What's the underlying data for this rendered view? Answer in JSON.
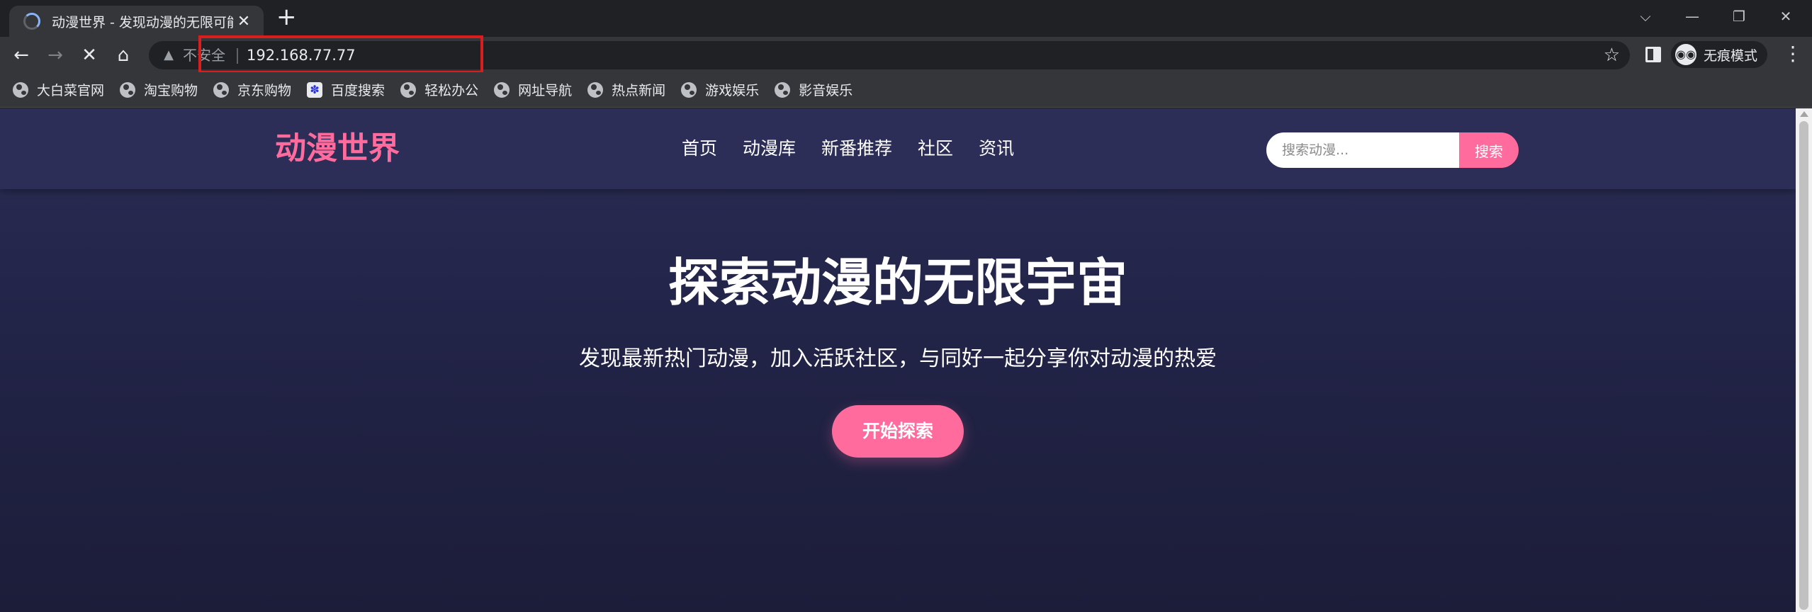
{
  "browser": {
    "tab": {
      "title": "动漫世界 - 发现动漫的无限可能",
      "close_glyph": "✕"
    },
    "new_tab_glyph": "+",
    "window_controls": {
      "tab_search": "⌵",
      "minimize": "—",
      "restore": "❐",
      "close": "✕"
    },
    "toolbar": {
      "back_glyph": "←",
      "forward_glyph": "→",
      "stop_glyph": "✕",
      "home_glyph": "⌂",
      "security_label": "不安全",
      "url": "192.168.77.77",
      "star_glyph": "☆",
      "profile_label": "无痕模式",
      "menu_glyph": "⋮"
    },
    "bookmarks": [
      {
        "label": "大白菜官网",
        "icon": "globe-icon"
      },
      {
        "label": "淘宝购物",
        "icon": "globe-icon"
      },
      {
        "label": "京东购物",
        "icon": "globe-icon"
      },
      {
        "label": "百度搜索",
        "icon": "baidu-paw-icon"
      },
      {
        "label": "轻松办公",
        "icon": "globe-icon"
      },
      {
        "label": "网址导航",
        "icon": "globe-icon"
      },
      {
        "label": "热点新闻",
        "icon": "globe-icon"
      },
      {
        "label": "游戏娱乐",
        "icon": "globe-icon"
      },
      {
        "label": "影音娱乐",
        "icon": "globe-icon"
      }
    ]
  },
  "site": {
    "logo": "动漫世界",
    "nav": [
      "首页",
      "动漫库",
      "新番推荐",
      "社区",
      "资讯"
    ],
    "search": {
      "placeholder": "搜索动漫...",
      "button": "搜索"
    },
    "hero": {
      "title": "探索动漫的无限宇宙",
      "subtitle": "发现最新热门动漫，加入活跃社区，与同好一起分享你对动漫的热爱",
      "cta": "开始探索"
    },
    "colors": {
      "accent": "#ff6b9d",
      "header_bg": "#2c2e57",
      "hero_bg": "#23254a",
      "annotation_box": "#d81e1e"
    }
  }
}
